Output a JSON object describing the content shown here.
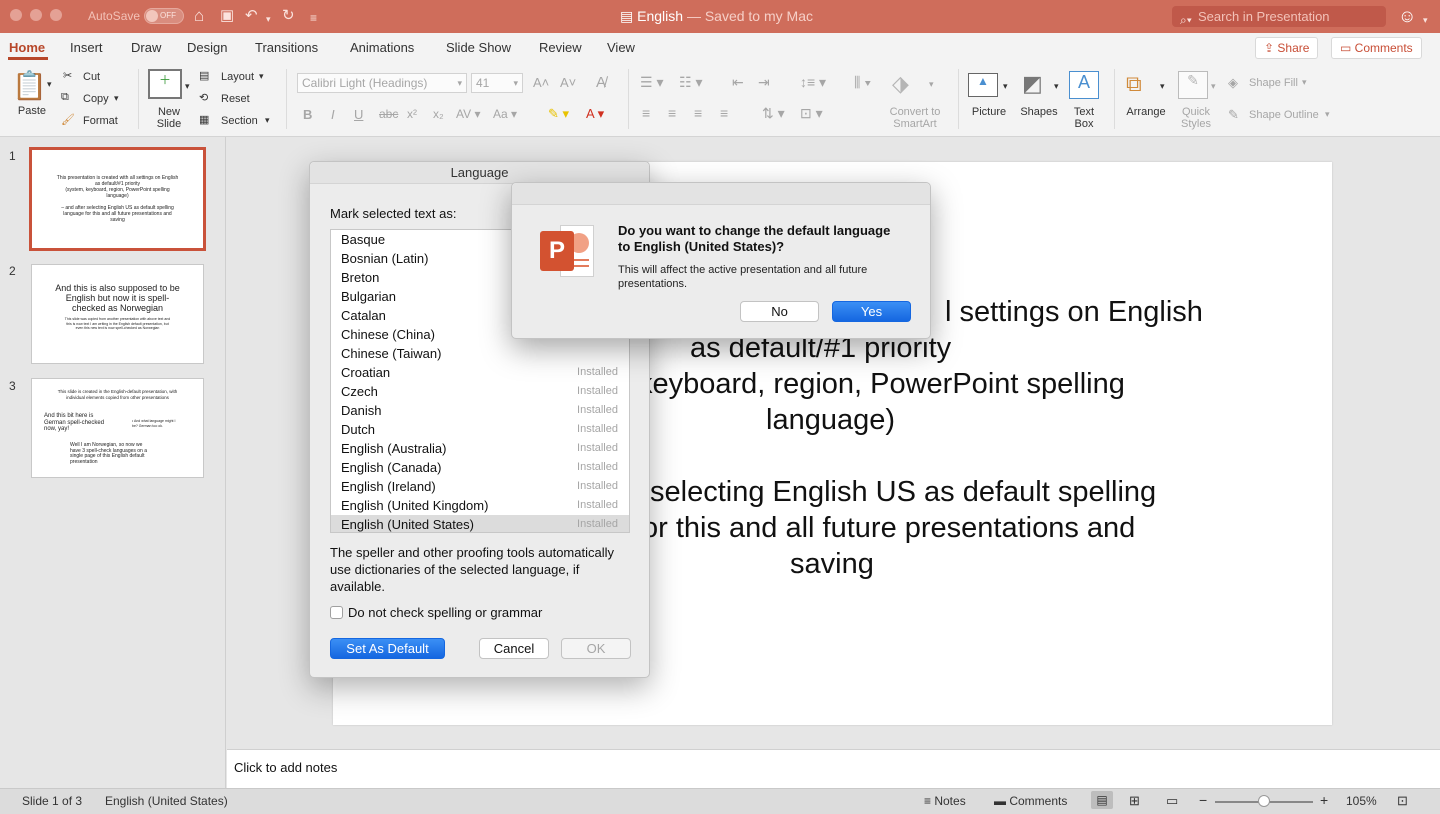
{
  "titlebar": {
    "autosave_label": "AutoSave",
    "autosave_state": "OFF",
    "doc_title": "English",
    "doc_status": "— Saved to my Mac",
    "search_placeholder": "Search in Presentation"
  },
  "menu": {
    "tabs": [
      "Home",
      "Insert",
      "Draw",
      "Design",
      "Transitions",
      "Animations",
      "Slide Show",
      "Review",
      "View"
    ],
    "share_label": "Share",
    "comments_label": "Comments"
  },
  "ribbon": {
    "paste": "Paste",
    "cut": "Cut",
    "copy": "Copy",
    "format": "Format",
    "new_slide": [
      "New",
      "Slide"
    ],
    "layout": "Layout",
    "reset": "Reset",
    "section": "Section",
    "font_name": "Calibri Light (Headings)",
    "font_size": "41",
    "convert": [
      "Convert to",
      "SmartArt"
    ],
    "picture": "Picture",
    "shapes": "Shapes",
    "textbox": [
      "Text",
      "Box"
    ],
    "arrange": "Arrange",
    "quick_styles": [
      "Quick",
      "Styles"
    ],
    "shape_fill": "Shape Fill",
    "shape_outline": "Shape Outline"
  },
  "thumbnails": [
    {
      "num": "1",
      "lines": [
        "This presentation is created with all settings on English",
        "as default/#1 priority",
        "(system, keyboard, region, PowerPoint spelling",
        "language)",
        "",
        "– and after selecting English US as default spelling",
        "language for this and all future presentations and",
        "saving"
      ]
    },
    {
      "num": "2",
      "title": [
        "And this is also supposed to be",
        "English but now it is spell-",
        "checked as Norwegian"
      ],
      "body": [
        "This slide was copied from another presentation with above text and",
        "this is now text I am writing in the English default presentation, but",
        "even this new text is now spell-checked as Norwegian"
      ]
    },
    {
      "num": "3",
      "head": [
        "This slide is created in the English-default presentation, with",
        "individual elements copied from other presentations"
      ],
      "left": [
        "And this bit here is",
        "German spell-checked",
        "now, yay!"
      ],
      "right": [
        "• And what language might I",
        "be? German too ok."
      ],
      "bottom": [
        "Well I am Norwegian, so now we",
        "have 3 spell-check languages on a",
        "single page of this English default",
        "presentation"
      ]
    }
  ],
  "slide_lines": [
    "l settings on English",
    "as default/#1 priority",
    "keyboard, region, PowerPoint spelling",
    "language)",
    "selecting English US as default spelling",
    "or this and all future presentations and",
    "saving"
  ],
  "notes_placeholder": "Click to add notes",
  "status": {
    "slide": "Slide 1 of 3",
    "language": "English (United States)",
    "notes": "Notes",
    "comments": "Comments",
    "zoom": "105%"
  },
  "language_dialog": {
    "title": "Language",
    "prompt": "Mark selected text as:",
    "languages": [
      {
        "name": "Basque",
        "status": ""
      },
      {
        "name": "Bosnian (Latin)",
        "status": ""
      },
      {
        "name": "Breton",
        "status": ""
      },
      {
        "name": "Bulgarian",
        "status": ""
      },
      {
        "name": "Catalan",
        "status": ""
      },
      {
        "name": "Chinese (China)",
        "status": ""
      },
      {
        "name": "Chinese (Taiwan)",
        "status": ""
      },
      {
        "name": "Croatian",
        "status": "Installed"
      },
      {
        "name": "Czech",
        "status": "Installed"
      },
      {
        "name": "Danish",
        "status": "Installed"
      },
      {
        "name": "Dutch",
        "status": "Installed"
      },
      {
        "name": "English (Australia)",
        "status": "Installed"
      },
      {
        "name": "English (Canada)",
        "status": "Installed"
      },
      {
        "name": "English (Ireland)",
        "status": "Installed"
      },
      {
        "name": "English (United Kingdom)",
        "status": "Installed"
      },
      {
        "name": "English (United States)",
        "status": "Installed"
      }
    ],
    "selected": "English (United States)",
    "info": [
      "The speller and other proofing tools automatically",
      "use dictionaries of the selected language, if",
      "available."
    ],
    "checkbox_label": "Do not check spelling or grammar",
    "set_default": "Set As Default",
    "cancel": "Cancel",
    "ok": "OK"
  },
  "alert": {
    "question": [
      "Do you want to change the default language",
      "to English (United States)?"
    ],
    "detail": [
      "This will affect the active presentation and all future",
      "presentations."
    ],
    "no": "No",
    "yes": "Yes"
  },
  "colors": {
    "accent": "#b7472a",
    "titlebar": "#cf6d5b",
    "primary_button": "#1a73e8"
  }
}
